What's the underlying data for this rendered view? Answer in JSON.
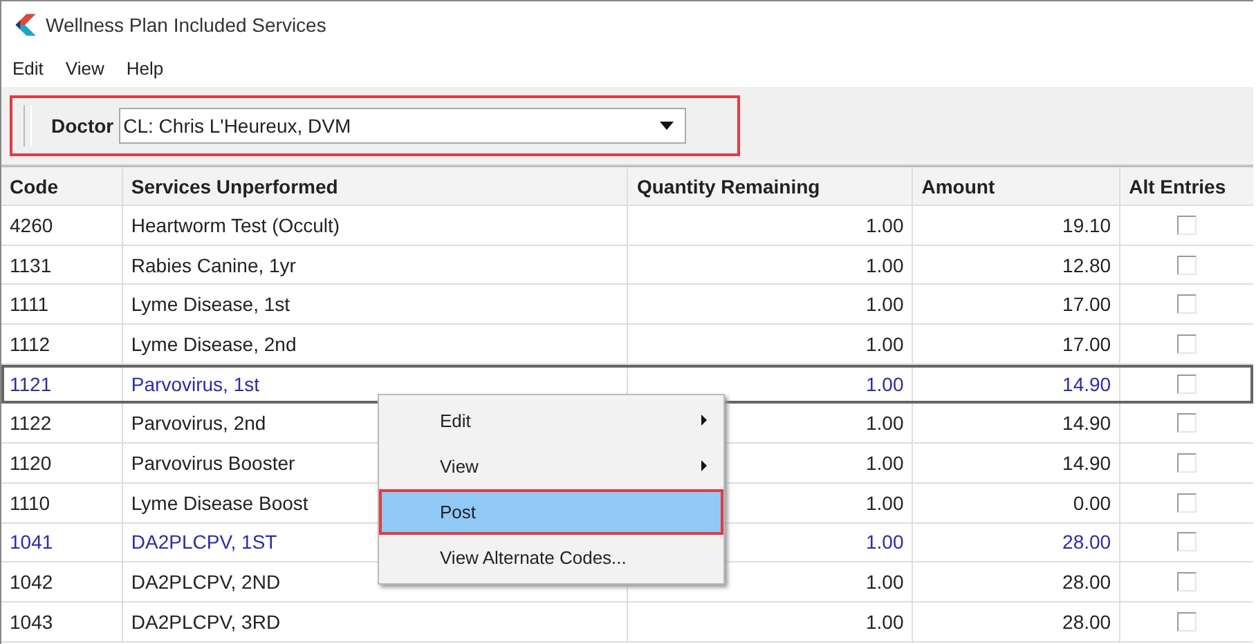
{
  "window": {
    "title": "Wellness Plan Included Services"
  },
  "menu_bar": [
    {
      "label": "Edit"
    },
    {
      "label": "View"
    },
    {
      "label": "Help"
    }
  ],
  "toolbar": {
    "annotated": true,
    "doctor": {
      "label": "Doctor",
      "value": "CL: Chris L'Heureux, DVM"
    }
  },
  "table": {
    "columns": [
      "Code",
      "Services Unperformed",
      "Quantity Remaining",
      "Amount",
      "Alt Entries"
    ],
    "rows": [
      {
        "code": "4260",
        "service": "Heartworm Test (Occult)",
        "quantity": "1.00",
        "amount": "19.10",
        "alt_entries": false,
        "highlighted": false,
        "selected": false
      },
      {
        "code": "1131",
        "service": "Rabies Canine, 1yr",
        "quantity": "1.00",
        "amount": "12.80",
        "alt_entries": false,
        "highlighted": false,
        "selected": false
      },
      {
        "code": "1111",
        "service": "Lyme Disease, 1st",
        "quantity": "1.00",
        "amount": "17.00",
        "alt_entries": false,
        "highlighted": false,
        "selected": false
      },
      {
        "code": "1112",
        "service": "Lyme Disease, 2nd",
        "quantity": "1.00",
        "amount": "17.00",
        "alt_entries": false,
        "highlighted": false,
        "selected": false
      },
      {
        "code": "1121",
        "service": "Parvovirus, 1st",
        "quantity": "1.00",
        "amount": "14.90",
        "alt_entries": false,
        "highlighted": true,
        "selected": true
      },
      {
        "code": "1122",
        "service": "Parvovirus, 2nd",
        "quantity": "1.00",
        "amount": "14.90",
        "alt_entries": false,
        "highlighted": false,
        "selected": false
      },
      {
        "code": "1120",
        "service": "Parvovirus Booster",
        "quantity": "1.00",
        "amount": "14.90",
        "alt_entries": false,
        "highlighted": false,
        "selected": false
      },
      {
        "code": "1110",
        "service": "Lyme Disease Boost",
        "quantity": "1.00",
        "amount": "0.00",
        "alt_entries": false,
        "highlighted": false,
        "selected": false
      },
      {
        "code": "1041",
        "service": "DA2PLCPV, 1ST",
        "quantity": "1.00",
        "amount": "28.00",
        "alt_entries": false,
        "highlighted": true,
        "selected": false
      },
      {
        "code": "1042",
        "service": "DA2PLCPV, 2ND",
        "quantity": "1.00",
        "amount": "28.00",
        "alt_entries": false,
        "highlighted": false,
        "selected": false
      },
      {
        "code": "1043",
        "service": "DA2PLCPV, 3RD",
        "quantity": "1.00",
        "amount": "28.00",
        "alt_entries": false,
        "highlighted": false,
        "selected": false
      }
    ]
  },
  "context_menu": [
    {
      "label": "Edit",
      "submenu": true,
      "selected": false,
      "annotated": false
    },
    {
      "label": "View",
      "submenu": true,
      "selected": false,
      "annotated": false
    },
    {
      "label": "Post",
      "submenu": false,
      "selected": true,
      "annotated": true
    },
    {
      "label": "View Alternate Codes...",
      "submenu": false,
      "selected": false,
      "annotated": false
    }
  ]
}
